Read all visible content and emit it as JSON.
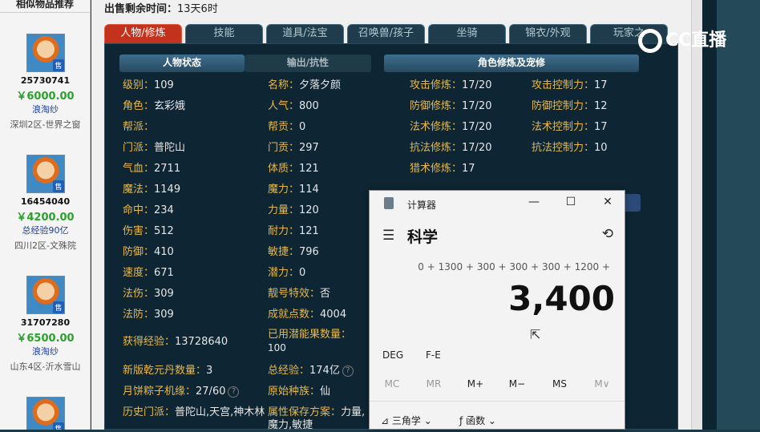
{
  "sidebar": {
    "title": "相似物品推荐",
    "items": [
      {
        "id": "25730741",
        "price": "￥6000.00",
        "seller": "浪淘纱",
        "server": "深圳2区-世界之窗",
        "badge": "售"
      },
      {
        "id": "16454040",
        "price": "￥4200.00",
        "seller": "总经验90亿",
        "server": "四川2区-文殊院",
        "badge": "售"
      },
      {
        "id": "31707280",
        "price": "￥6500.00",
        "seller": "浪淘纱",
        "server": "山东4区-沂水雪山",
        "badge": "售"
      },
      {
        "id": "",
        "price": "",
        "seller": "",
        "server": "",
        "badge": "售"
      }
    ]
  },
  "sale": {
    "label": "出售剩余时间：",
    "value": "13天6时"
  },
  "tabs": [
    "人物/修炼",
    "技能",
    "道具/法宝",
    "召唤兽/孩子",
    "坐骑",
    "锦衣/外观",
    "玩家之"
  ],
  "headers": {
    "status": "人物状态",
    "output": "输出/抗性",
    "cultivation": "角色修炼及宠修"
  },
  "stats": {
    "level_k": "级别：",
    "level_v": "109",
    "name_k": "名称：",
    "name_v": "夕落夕颜",
    "role_k": "角色：",
    "role_v": "玄彩娥",
    "pop_k": "人气：",
    "pop_v": "800",
    "gang_k": "帮派：",
    "gang_v": "",
    "contrib_k": "帮贡：",
    "contrib_v": "0",
    "school_k": "门派：",
    "school_v": "普陀山",
    "mgong_k": "门贡：",
    "mgong_v": "297",
    "hp_k": "气血：",
    "hp_v": "2711",
    "tizhi_k": "体质：",
    "tizhi_v": "121",
    "mp_k": "魔法：",
    "mp_v": "1149",
    "moli_k": "魔力：",
    "moli_v": "114",
    "hit_k": "命中：",
    "hit_v": "234",
    "str_k": "力量：",
    "str_v": "120",
    "dmg_k": "伤害：",
    "dmg_v": "512",
    "end_k": "耐力：",
    "end_v": "121",
    "def_k": "防御：",
    "def_v": "410",
    "agi_k": "敏捷：",
    "agi_v": "796",
    "spd_k": "速度：",
    "spd_v": "671",
    "pot_k": "潜力：",
    "pot_v": "0",
    "mdmg_k": "法伤：",
    "mdmg_v": "309",
    "spec_k": "靓号特效：",
    "spec_v": "否",
    "mdef_k": "法防：",
    "mdef_v": "309",
    "ach_k": "成就点数：",
    "ach_v": "4004",
    "exp_k": "获得经验：",
    "exp_v": "13728640",
    "used_k": "已用潜能果数量：",
    "used_v": "100",
    "qy_k": "新版乾元丹数量：",
    "qy_v": "3",
    "total_k": "总经验：",
    "total_v": "174亿",
    "zz_k": "月饼粽子机缘：",
    "zz_v": "27/60",
    "race_k": "原始种族：",
    "race_v": "仙",
    "hist_k": "历史门派：",
    "hist_v": "普陀山,天宫,神木林",
    "attr_k": "属性保存方案：",
    "attr_v": "力量,魔力,敏捷"
  },
  "cultivation": {
    "atk_k": "攻击修炼：",
    "atk_v": "17/20",
    "atkc_k": "攻击控制力：",
    "atkc_v": "17",
    "def_k": "防御修炼：",
    "def_v": "17/20",
    "defc_k": "防御控制力：",
    "defc_v": "12",
    "mag_k": "法术修炼：",
    "mag_v": "17/20",
    "magc_k": "法术控制力：",
    "magc_v": "17",
    "res_k": "抗法修炼：",
    "res_v": "17/20",
    "resc_k": "抗法控制力：",
    "resc_v": "10",
    "hunt_k": "猎术修炼：",
    "hunt_v": "17"
  },
  "calculator": {
    "title": "计算器",
    "mode": "科学",
    "expression": "0 + 1300 + 300 + 300 + 300 + 1200 +",
    "result": "3,400",
    "angle": "DEG",
    "fe": "F-E",
    "mem": [
      "MC",
      "MR",
      "M+",
      "M−",
      "MS",
      "M∨"
    ],
    "trig": "三角学",
    "func": "函数"
  },
  "logo": {
    "text": "CC直播"
  }
}
